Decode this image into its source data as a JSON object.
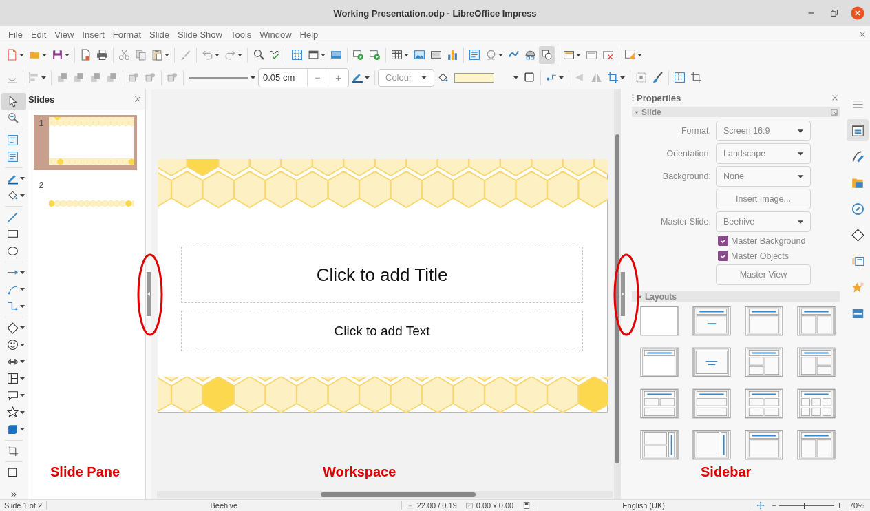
{
  "window": {
    "title": "Working Presentation.odp - LibreOffice Impress"
  },
  "menu": [
    "File",
    "Edit",
    "View",
    "Insert",
    "Format",
    "Slide",
    "Slide Show",
    "Tools",
    "Window",
    "Help"
  ],
  "line_toolbar": {
    "line_width": "0.05 cm",
    "minus": "−",
    "plus": "+",
    "area_style": "Colour"
  },
  "left_toolbar_more": "»",
  "slides_pane": {
    "title": "Slides",
    "slides": [
      {
        "number": "1",
        "selected": true
      },
      {
        "number": "2",
        "selected": false
      }
    ]
  },
  "slide": {
    "title_placeholder": "Click to add Title",
    "text_placeholder": "Click to add Text"
  },
  "sidebar": {
    "title": "Properties",
    "slide_section": "Slide",
    "controls": [
      {
        "kind": "dropdown",
        "label": "Format:",
        "value": "Screen 16:9"
      },
      {
        "kind": "dropdown",
        "label": "Orientation:",
        "value": "Landscape"
      },
      {
        "kind": "dropdown",
        "label": "Background:",
        "value": "None"
      },
      {
        "kind": "button",
        "text": "Insert Image..."
      },
      {
        "kind": "dropdown",
        "label": "Master Slide:",
        "value": "Beehive"
      },
      {
        "kind": "checkbox",
        "text": "Master Background",
        "checked": true
      },
      {
        "kind": "checkbox",
        "text": "Master Objects",
        "checked": true
      },
      {
        "kind": "button",
        "text": "Master View"
      }
    ],
    "layouts_section": "Layouts"
  },
  "deck_tabs": [
    {
      "selected": false
    },
    {
      "selected": true
    },
    {
      "selected": false
    },
    {
      "selected": false
    },
    {
      "selected": false
    },
    {
      "selected": false
    },
    {
      "selected": false
    },
    {
      "selected": false
    },
    {
      "selected": false
    }
  ],
  "annotations": [
    {
      "text": "Slide Pane"
    },
    {
      "text": "Workspace"
    },
    {
      "text": "Sidebar"
    }
  ],
  "status_bar": {
    "slide": "Slide 1 of 2",
    "master": "Beehive",
    "position": "22.00 / 0.19",
    "size": "0.00 x 0.00",
    "language": "English (UK)",
    "zoom_out": "−",
    "zoom_in": "+",
    "zoom": {
      "level": 0.45
    },
    "zoom_percent": "70%"
  }
}
